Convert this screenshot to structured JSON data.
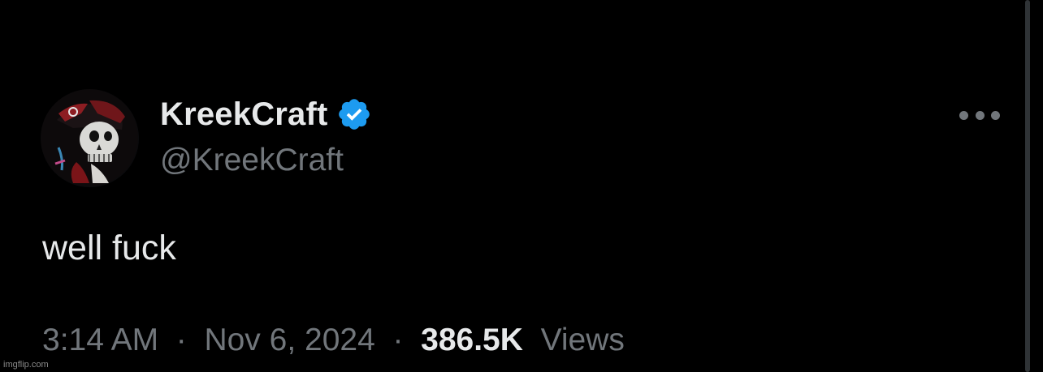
{
  "tweet": {
    "display_name": "KreekCraft",
    "handle": "@KreekCraft",
    "text": "well fuck",
    "time": "3:14 AM",
    "date": "Nov 6, 2024",
    "separator": "·",
    "view_count": "386.5K",
    "views_label": "Views",
    "verified": true
  },
  "icons": {
    "verified": "verified-badge-icon",
    "more": "more-options-icon"
  },
  "colors": {
    "background": "#000000",
    "primary_text": "#e7e9ea",
    "secondary_text": "#71767b",
    "verified_blue": "#1d9bf0"
  },
  "watermark": "imgflip.com"
}
